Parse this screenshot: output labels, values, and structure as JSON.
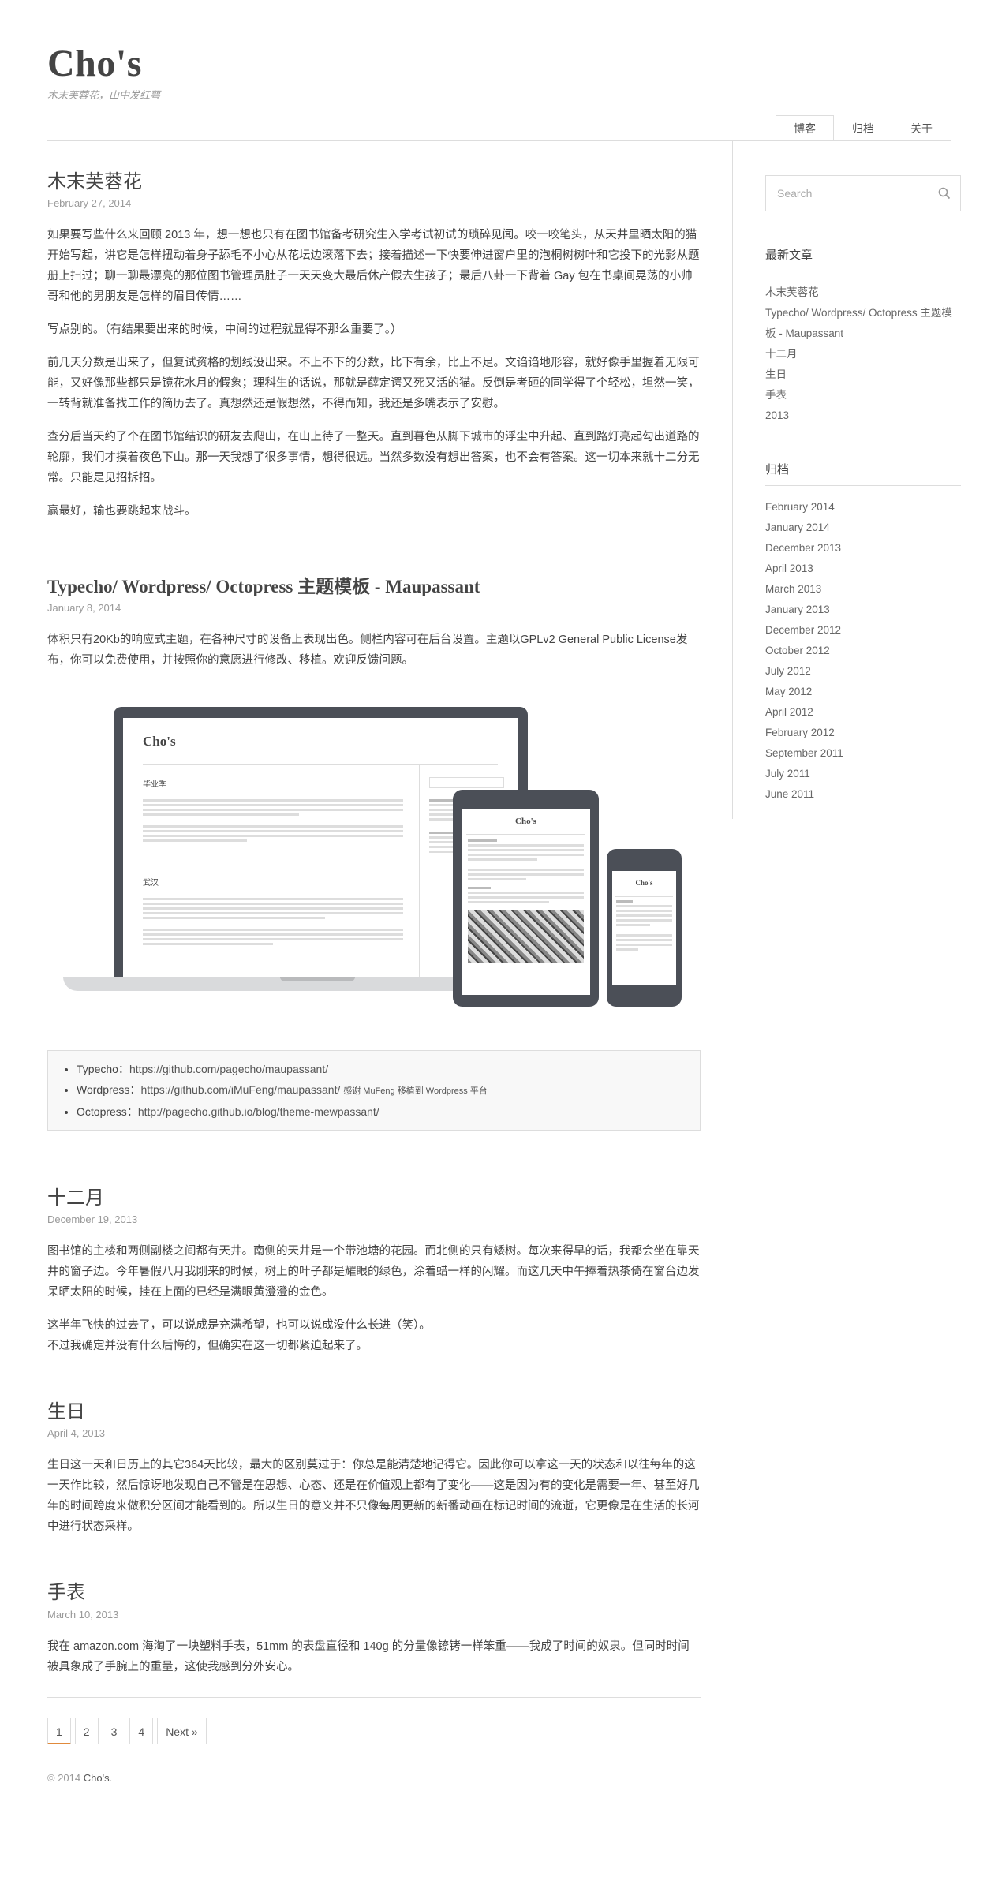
{
  "site": {
    "title": "Cho's",
    "description": "木末芙蓉花，山中发红萼"
  },
  "nav": [
    {
      "label": "博客",
      "active": true
    },
    {
      "label": "归档",
      "active": false
    },
    {
      "label": "关于",
      "active": false
    }
  ],
  "posts": [
    {
      "title": "木末芙蓉花",
      "date": "February 27, 2014",
      "paragraphs": [
        "如果要写些什么来回顾 2013 年，想一想也只有在图书馆备考研究生入学考试初试的琐碎见闻。咬一咬笔头，从天井里晒太阳的猫开始写起，讲它是怎样扭动着身子舔毛不小心从花坛边滚落下去；接着描述一下快要伸进窗户里的泡桐树树叶和它投下的光影从题册上扫过；聊一聊最漂亮的那位图书管理员肚子一天天变大最后休产假去生孩子；最后八卦一下背着 Gay 包在书桌间晃荡的小帅哥和他的男朋友是怎样的眉目传情……",
        "写点别的。（有结果要出来的时候，中间的过程就显得不那么重要了。）",
        "前几天分数是出来了，但复试资格的划线没出来。不上不下的分数，比下有余，比上不足。文诌诌地形容，就好像手里握着无限可能，又好像那些都只是镜花水月的假象；理科生的话说，那就是薛定谔又死又活的猫。反倒是考砸的同学得了个轻松，坦然一笑，一转背就准备找工作的简历去了。真想然还是假想然，不得而知，我还是多嘴表示了安慰。",
        "查分后当天约了个在图书馆结识的研友去爬山，在山上待了一整天。直到暮色从脚下城市的浮尘中升起、直到路灯亮起勾出道路的轮廓，我们才摸着夜色下山。那一天我想了很多事情，想得很远。当然多数没有想出答案，也不会有答案。这一切本来就十二分无常。只能是见招拆招。",
        "赢最好，输也要跳起来战斗。"
      ]
    },
    {
      "title": "Typecho/ Wordpress/ Octopress 主题模板 - Maupassant",
      "date": "January 8, 2014",
      "paragraphs": [
        "体积只有20Kb的响应式主题，在各种尺寸的设备上表现出色。侧栏内容可在后台设置。主题以GPLv2 General Public License发布，你可以免费使用，并按照你的意愿进行修改、移植。欢迎反馈问题。"
      ],
      "mockup": {
        "laptop_title": "Cho's",
        "laptop_post1": "毕业季",
        "laptop_post2": "武汉",
        "tablet_title": "Cho's",
        "phone_title": "Cho's"
      },
      "links": [
        {
          "name": "Typecho：",
          "url": "https://github.com/pagecho/maupassant/",
          "note": ""
        },
        {
          "name": "Wordpress：",
          "url": "https://github.com/iMuFeng/maupassant/",
          "note": "感谢 MuFeng 移植到 Wordpress 平台"
        },
        {
          "name": "Octopress：",
          "url": "http://pagecho.github.io/blog/theme-mewpassant/",
          "note": ""
        }
      ]
    },
    {
      "title": "十二月",
      "date": "December 19, 2013",
      "paragraphs": [
        "图书馆的主楼和两侧副楼之间都有天井。南侧的天井是一个带池塘的花园。而北侧的只有矮树。每次来得早的话，我都会坐在靠天井的窗子边。今年暑假八月我刚来的时候，树上的叶子都是耀眼的绿色，涂着蜡一样的闪耀。而这几天中午捧着热茶倚在窗台边发呆晒太阳的时候，挂在上面的已经是满眼黄澄澄的金色。",
        "这半年飞快的过去了，可以说成是充满希望，也可以说成没什么长进（笑）。\n不过我确定并没有什么后悔的，但确实在这一切都紧迫起来了。"
      ]
    },
    {
      "title": "生日",
      "date": "April 4, 2013",
      "paragraphs": [
        "生日这一天和日历上的其它364天比较，最大的区别莫过于：你总是能清楚地记得它。因此你可以拿这一天的状态和以往每年的这一天作比较，然后惊讶地发现自己不管是在思想、心态、还是在价值观上都有了变化——这是因为有的变化是需要一年、甚至好几年的时间跨度来做积分区间才能看到的。所以生日的意义并不只像每周更新的新番动画在标记时间的流逝，它更像是在生活的长河中进行状态采样。"
      ]
    },
    {
      "title": "手表",
      "date": "March 10, 2013",
      "paragraphs": [
        "我在 amazon.com 海淘了一块塑料手表，51mm 的表盘直径和 140g 的分量像镣铐一样笨重——我成了时间的奴隶。但同时时间被具象成了手腕上的重量，这使我感到分外安心。"
      ]
    }
  ],
  "pagination": {
    "pages": [
      "1",
      "2",
      "3",
      "4"
    ],
    "next": "Next »"
  },
  "footer": {
    "copyright": "© 2014 ",
    "site": "Cho's",
    "period": "."
  },
  "sidebar": {
    "search_placeholder": "Search",
    "recent_title": "最新文章",
    "recent": [
      "木末芙蓉花",
      "Typecho/ Wordpress/ Octopress 主题模板 - Maupassant",
      "十二月",
      "生日",
      "手表",
      "2013"
    ],
    "archive_title": "归档",
    "archives": [
      "February 2014",
      "January 2014",
      "December 2013",
      "April 2013",
      "March 2013",
      "January 2013",
      "December 2012",
      "October 2012",
      "July 2012",
      "May 2012",
      "April 2012",
      "February 2012",
      "September 2011",
      "July 2011",
      "June 2011"
    ]
  }
}
